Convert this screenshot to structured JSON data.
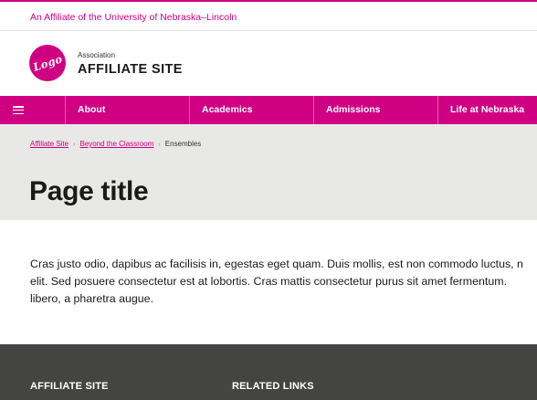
{
  "topbar": {
    "affiliate_link": "An Affiliate of the University of Nebraska–Lincoln"
  },
  "brand": {
    "logo_text": "Logo",
    "association": "Association",
    "site_name": "AFFILIATE SITE"
  },
  "nav": {
    "items": [
      {
        "label": "About"
      },
      {
        "label": "Academics"
      },
      {
        "label": "Admissions"
      },
      {
        "label": "Life at Nebraska"
      }
    ]
  },
  "breadcrumb": {
    "items": [
      {
        "label": "Affiliate Site"
      },
      {
        "label": "Beyond the Classroom"
      }
    ],
    "current": "Ensembles"
  },
  "page": {
    "title": "Page title",
    "body_lines": [
      "Cras justo odio, dapibus ac facilisis in, egestas eget quam. Duis mollis, est non commodo luctus, n",
      "elit. Sed posuere consectetur est at lobortis. Cras mattis consectetur purus sit amet fermentum. ",
      "libero, a pharetra augue."
    ]
  },
  "footer": {
    "heading_left": "AFFILIATE SITE",
    "heading_right": "RELATED LINKS"
  },
  "colors": {
    "brand": "#d00083",
    "hero_bg": "#e8e8e6",
    "footer_bg": "#444443"
  },
  "icons": {
    "menu": "hamburger-menu-icon",
    "breadcrumb_separator": "chevron-right-icon"
  }
}
